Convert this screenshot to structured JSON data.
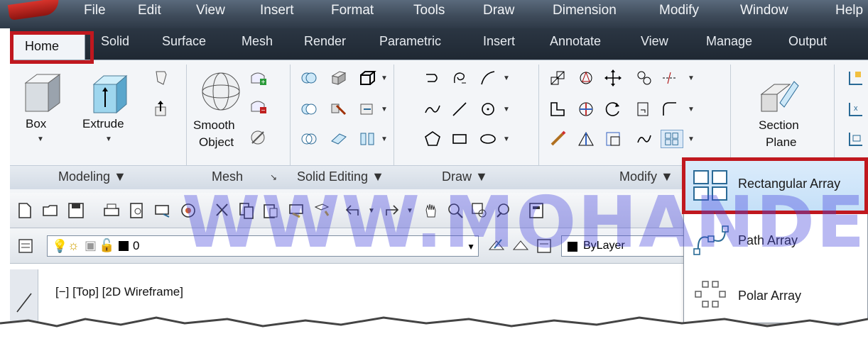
{
  "menubar": {
    "items": [
      "File",
      "Edit",
      "View",
      "Insert",
      "Format",
      "Tools",
      "Draw",
      "Dimension",
      "Modify",
      "Window",
      "Help"
    ]
  },
  "ribbon_tabs": {
    "active": "Home",
    "items": [
      "Solid",
      "Surface",
      "Mesh",
      "Render",
      "Parametric",
      "Insert",
      "Annotate",
      "View",
      "Manage",
      "Output"
    ]
  },
  "modeling": {
    "box_label": "Box",
    "extrude_label": "Extrude",
    "panel_title": "Modeling ▼"
  },
  "mesh": {
    "smooth_label_1": "Smooth",
    "smooth_label_2": "Object",
    "panel_title": "Mesh",
    "launcher": "↘"
  },
  "solid_editing": {
    "panel_title": "Solid Editing ▼"
  },
  "draw": {
    "panel_title": "Draw ▼"
  },
  "modify": {
    "panel_title": "Modify ▼"
  },
  "section": {
    "label_1": "Section",
    "label_2": "Plane"
  },
  "layer_toolbar": {
    "layer_value": "0",
    "color_value": "ByLayer"
  },
  "viewport": {
    "label": "[−] [Top] [2D Wireframe]"
  },
  "array_menu": {
    "items": [
      {
        "label": "Rectangular Array",
        "icon": "rectangular-array-icon"
      },
      {
        "label": "Path Array",
        "icon": "path-array-icon"
      },
      {
        "label": "Polar Array",
        "icon": "polar-array-icon"
      }
    ]
  },
  "watermark": "WWW.MOHANDES.ORG",
  "colors": {
    "menubar": "#3f4c5b",
    "ribbon": "#f3f5f8",
    "highlight": "#c0181f",
    "selected": "#c5e0f8",
    "watermark": "#4646dc"
  }
}
